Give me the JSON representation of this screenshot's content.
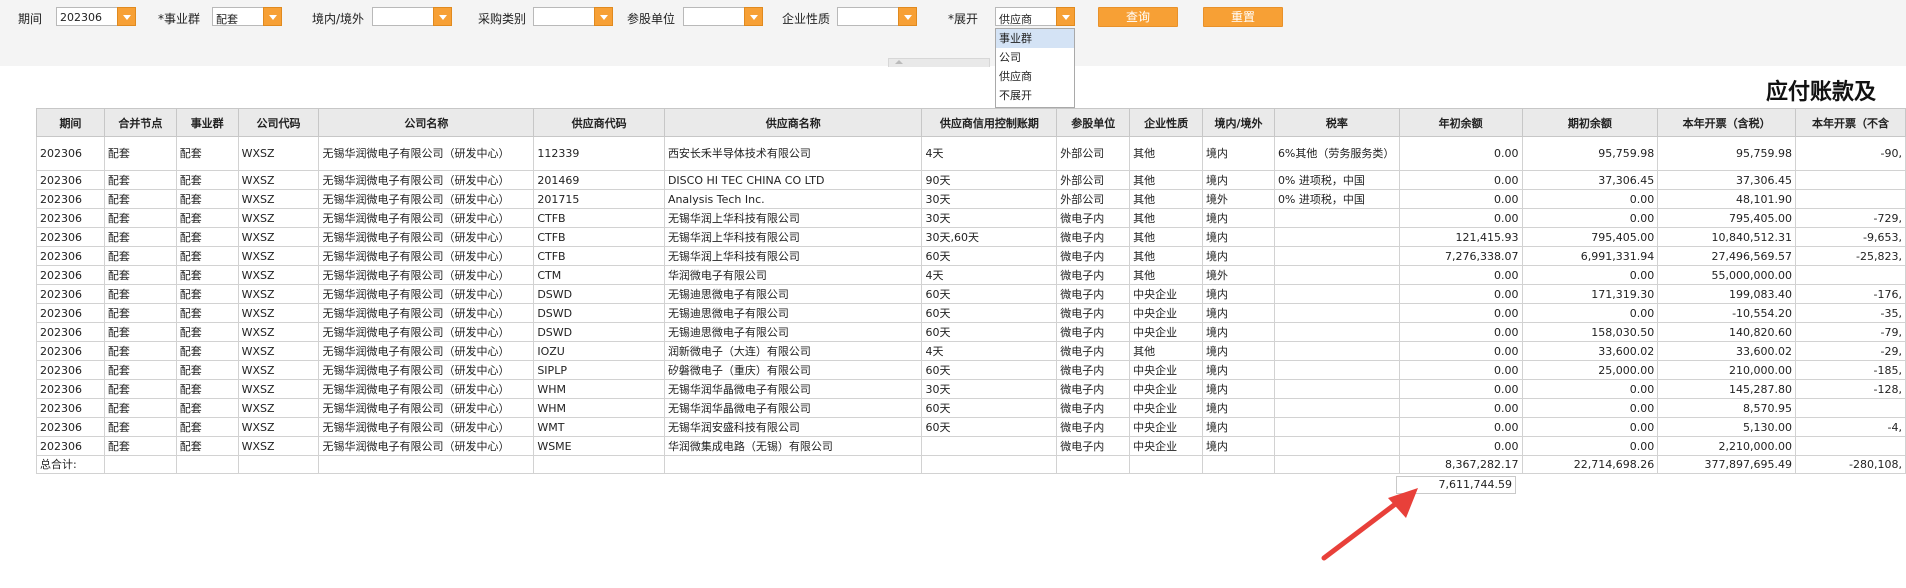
{
  "filters": {
    "period": {
      "label": "期间",
      "value": "202306"
    },
    "business_group": {
      "label": "*事业群",
      "value": "配套"
    },
    "domestic": {
      "label": "境内/境外",
      "value": ""
    },
    "purchase_type": {
      "label": "采购类别",
      "value": ""
    },
    "share_unit": {
      "label": "参股单位",
      "value": ""
    },
    "enterprise_nature": {
      "label": "企业性质",
      "value": ""
    },
    "expand": {
      "label": "*展开",
      "value": "供应商"
    },
    "query_label": "查询",
    "reset_label": "重置"
  },
  "expand_dropdown": {
    "options": [
      "事业群",
      "公司",
      "供应商",
      "不展开"
    ],
    "highlighted": "事业群"
  },
  "report": {
    "title": "应付账款及",
    "columns": [
      "期间",
      "合并节点",
      "事业群",
      "公司代码",
      "公司名称",
      "供应商代码",
      "供应商名称",
      "供应商信用控制账期",
      "参股单位",
      "企业性质",
      "境内/境外",
      "税率",
      "年初余额",
      "期初余额",
      "本年开票（含税）",
      "本年开票（不含"
    ],
    "rows": [
      [
        "202306",
        "配套",
        "配套",
        "WXSZ",
        "无锡华润微电子有限公司（研发中心）",
        "112339",
        "西安长禾半导体技术有限公司",
        "4天",
        "外部公司",
        "其他",
        "境内",
        "6%其他（劳务服务类）",
        "0.00",
        "95,759.98",
        "95,759.98",
        "-90,"
      ],
      [
        "202306",
        "配套",
        "配套",
        "WXSZ",
        "无锡华润微电子有限公司（研发中心）",
        "201469",
        "DISCO HI TEC CHINA CO LTD",
        "90天",
        "外部公司",
        "其他",
        "境内",
        "0% 进项税，中国",
        "0.00",
        "37,306.45",
        "37,306.45",
        ""
      ],
      [
        "202306",
        "配套",
        "配套",
        "WXSZ",
        "无锡华润微电子有限公司（研发中心）",
        "201715",
        "Analysis Tech Inc.",
        "30天",
        "外部公司",
        "其他",
        "境外",
        "0% 进项税，中国",
        "0.00",
        "0.00",
        "48,101.90",
        ""
      ],
      [
        "202306",
        "配套",
        "配套",
        "WXSZ",
        "无锡华润微电子有限公司（研发中心）",
        "CTFB",
        "无锡华润上华科技有限公司",
        "30天",
        "微电子内",
        "其他",
        "境内",
        "",
        "0.00",
        "0.00",
        "795,405.00",
        "-729,"
      ],
      [
        "202306",
        "配套",
        "配套",
        "WXSZ",
        "无锡华润微电子有限公司（研发中心）",
        "CTFB",
        "无锡华润上华科技有限公司",
        "30天,60天",
        "微电子内",
        "其他",
        "境内",
        "",
        "121,415.93",
        "795,405.00",
        "10,840,512.31",
        "-9,653,"
      ],
      [
        "202306",
        "配套",
        "配套",
        "WXSZ",
        "无锡华润微电子有限公司（研发中心）",
        "CTFB",
        "无锡华润上华科技有限公司",
        "60天",
        "微电子内",
        "其他",
        "境内",
        "",
        "7,276,338.07",
        "6,991,331.94",
        "27,496,569.57",
        "-25,823,"
      ],
      [
        "202306",
        "配套",
        "配套",
        "WXSZ",
        "无锡华润微电子有限公司（研发中心）",
        "CTM",
        "华润微电子有限公司",
        "4天",
        "微电子内",
        "其他",
        "境外",
        "",
        "0.00",
        "0.00",
        "55,000,000.00",
        ""
      ],
      [
        "202306",
        "配套",
        "配套",
        "WXSZ",
        "无锡华润微电子有限公司（研发中心）",
        "DSWD",
        "无锡迪思微电子有限公司",
        "60天",
        "微电子内",
        "中央企业",
        "境内",
        "",
        "0.00",
        "171,319.30",
        "199,083.40",
        "-176,"
      ],
      [
        "202306",
        "配套",
        "配套",
        "WXSZ",
        "无锡华润微电子有限公司（研发中心）",
        "DSWD",
        "无锡迪思微电子有限公司",
        "60天",
        "微电子内",
        "中央企业",
        "境内",
        "",
        "0.00",
        "0.00",
        "-10,554.20",
        "-35,"
      ],
      [
        "202306",
        "配套",
        "配套",
        "WXSZ",
        "无锡华润微电子有限公司（研发中心）",
        "DSWD",
        "无锡迪思微电子有限公司",
        "60天",
        "微电子内",
        "中央企业",
        "境内",
        "",
        "0.00",
        "158,030.50",
        "140,820.60",
        "-79,"
      ],
      [
        "202306",
        "配套",
        "配套",
        "WXSZ",
        "无锡华润微电子有限公司（研发中心）",
        "IOZU",
        "润新微电子（大连）有限公司",
        "4天",
        "微电子内",
        "其他",
        "境内",
        "",
        "0.00",
        "33,600.02",
        "33,600.02",
        "-29,"
      ],
      [
        "202306",
        "配套",
        "配套",
        "WXSZ",
        "无锡华润微电子有限公司（研发中心）",
        "SIPLP",
        "矽磐微电子（重庆）有限公司",
        "60天",
        "微电子内",
        "中央企业",
        "境内",
        "",
        "0.00",
        "25,000.00",
        "210,000.00",
        "-185,"
      ],
      [
        "202306",
        "配套",
        "配套",
        "WXSZ",
        "无锡华润微电子有限公司（研发中心）",
        "WHM",
        "无锡华润华晶微电子有限公司",
        "30天",
        "微电子内",
        "中央企业",
        "境内",
        "",
        "0.00",
        "0.00",
        "145,287.80",
        "-128,"
      ],
      [
        "202306",
        "配套",
        "配套",
        "WXSZ",
        "无锡华润微电子有限公司（研发中心）",
        "WHM",
        "无锡华润华晶微电子有限公司",
        "60天",
        "微电子内",
        "中央企业",
        "境内",
        "",
        "0.00",
        "0.00",
        "8,570.95",
        ""
      ],
      [
        "202306",
        "配套",
        "配套",
        "WXSZ",
        "无锡华润微电子有限公司（研发中心）",
        "WMT",
        "无锡华润安盛科技有限公司",
        "60天",
        "微电子内",
        "中央企业",
        "境内",
        "",
        "0.00",
        "0.00",
        "5,130.00",
        "-4,"
      ],
      [
        "202306",
        "配套",
        "配套",
        "WXSZ",
        "无锡华润微电子有限公司（研发中心）",
        "WSME",
        "华润微集成电路（无锡）有限公司",
        "",
        "微电子内",
        "中央企业",
        "境内",
        "",
        "0.00",
        "0.00",
        "2,210,000.00",
        ""
      ]
    ],
    "total": {
      "label": "总合计:",
      "year_begin": "8,367,282.17",
      "period_begin": "22,714,698.26",
      "invoice_with_tax": "377,897,695.49",
      "invoice_without_tax": "-280,108,"
    },
    "extra_value": "7,611,744.59"
  },
  "colors": {
    "accent": "#f7a035",
    "arrow": "#e8403a",
    "header_bg": "#eaeaea"
  }
}
